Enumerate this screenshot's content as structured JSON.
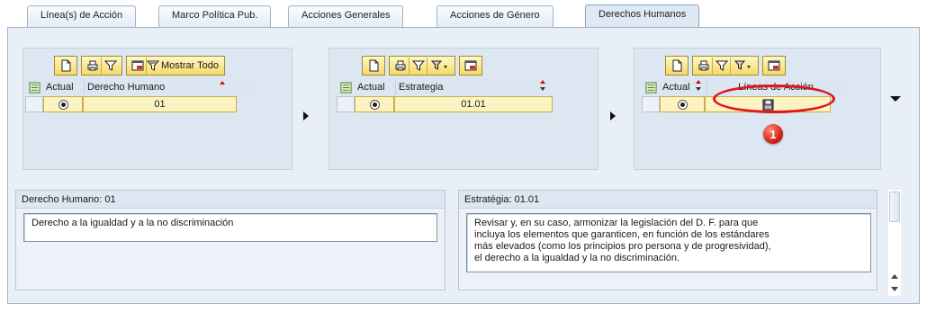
{
  "tabs": [
    {
      "label": "Línea(s) de Acción",
      "active": false
    },
    {
      "label": "Marco Política Pub.",
      "active": false
    },
    {
      "label": "Acciones Generales",
      "active": false
    },
    {
      "label": "Acciones de Género",
      "active": false
    },
    {
      "label": "Derechos Humanos",
      "active": true
    }
  ],
  "grids": {
    "derecho": {
      "toolbar_text": "Mostrar Todo",
      "col_actual": "Actual",
      "col_main": "Derecho Humano",
      "value": "01"
    },
    "estrategia": {
      "col_actual": "Actual",
      "col_main": "Estrategia",
      "value": "01.01"
    },
    "lineas": {
      "col_actual": "Actual",
      "col_main": "Líneas de Acción"
    }
  },
  "callout_number": "1",
  "details": {
    "derecho": {
      "title": "Derecho Humano: 01",
      "text": "Derecho a la igualdad y a la no discriminación"
    },
    "estrategia": {
      "title": "Estratégia: 01.01",
      "lines": [
        "Revisar y, en su caso, armonizar la legislación del D. F. para que",
        "incluya los elementos que garanticen, en función de los estándares",
        "más elevados (como los principios pro persona y de progresividad),",
        "el derecho a la igualdad y la no discriminación."
      ]
    }
  },
  "colors": {
    "highlight_red": "#e0161b",
    "toolbar_yellow": "#f5d968",
    "panel_blue": "#e9eff6"
  }
}
